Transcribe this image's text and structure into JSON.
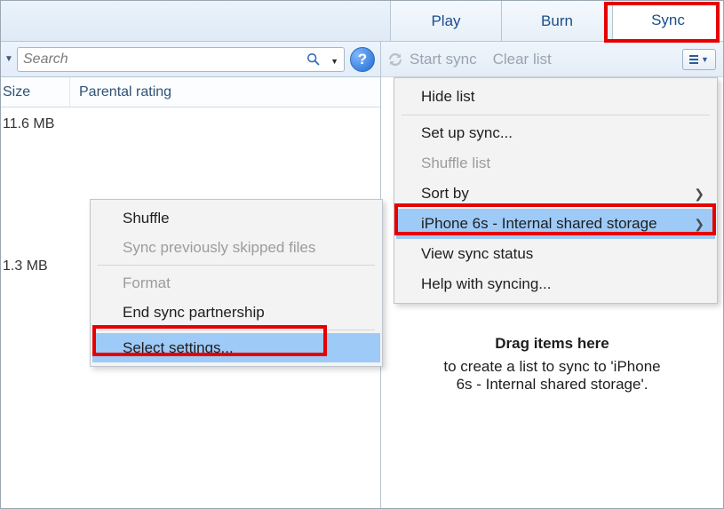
{
  "tabs": {
    "play": "Play",
    "burn": "Burn",
    "sync": "Sync"
  },
  "search": {
    "placeholder": "Search"
  },
  "columns": {
    "size": "Size",
    "rating": "Parental rating"
  },
  "rows": [
    {
      "size": "11.6 MB"
    },
    {
      "size": "1.3 MB"
    }
  ],
  "rightbar": {
    "start_sync": "Start sync",
    "clear_list": "Clear list"
  },
  "dropzone": {
    "title": "Drag items here",
    "line1": "to create a list to sync to 'iPhone",
    "line2": "6s - Internal shared storage'."
  },
  "menu_right": {
    "hide_list": "Hide list",
    "setup_sync": "Set up sync...",
    "shuffle_list": "Shuffle list",
    "sort_by": "Sort by",
    "device": "iPhone 6s - Internal shared storage",
    "view_status": "View sync status",
    "help_sync": "Help with syncing..."
  },
  "menu_left": {
    "shuffle": "Shuffle",
    "sync_prev": "Sync previously skipped files",
    "format": "Format",
    "end_partnership": "End sync partnership",
    "select_settings": "Select settings..."
  }
}
